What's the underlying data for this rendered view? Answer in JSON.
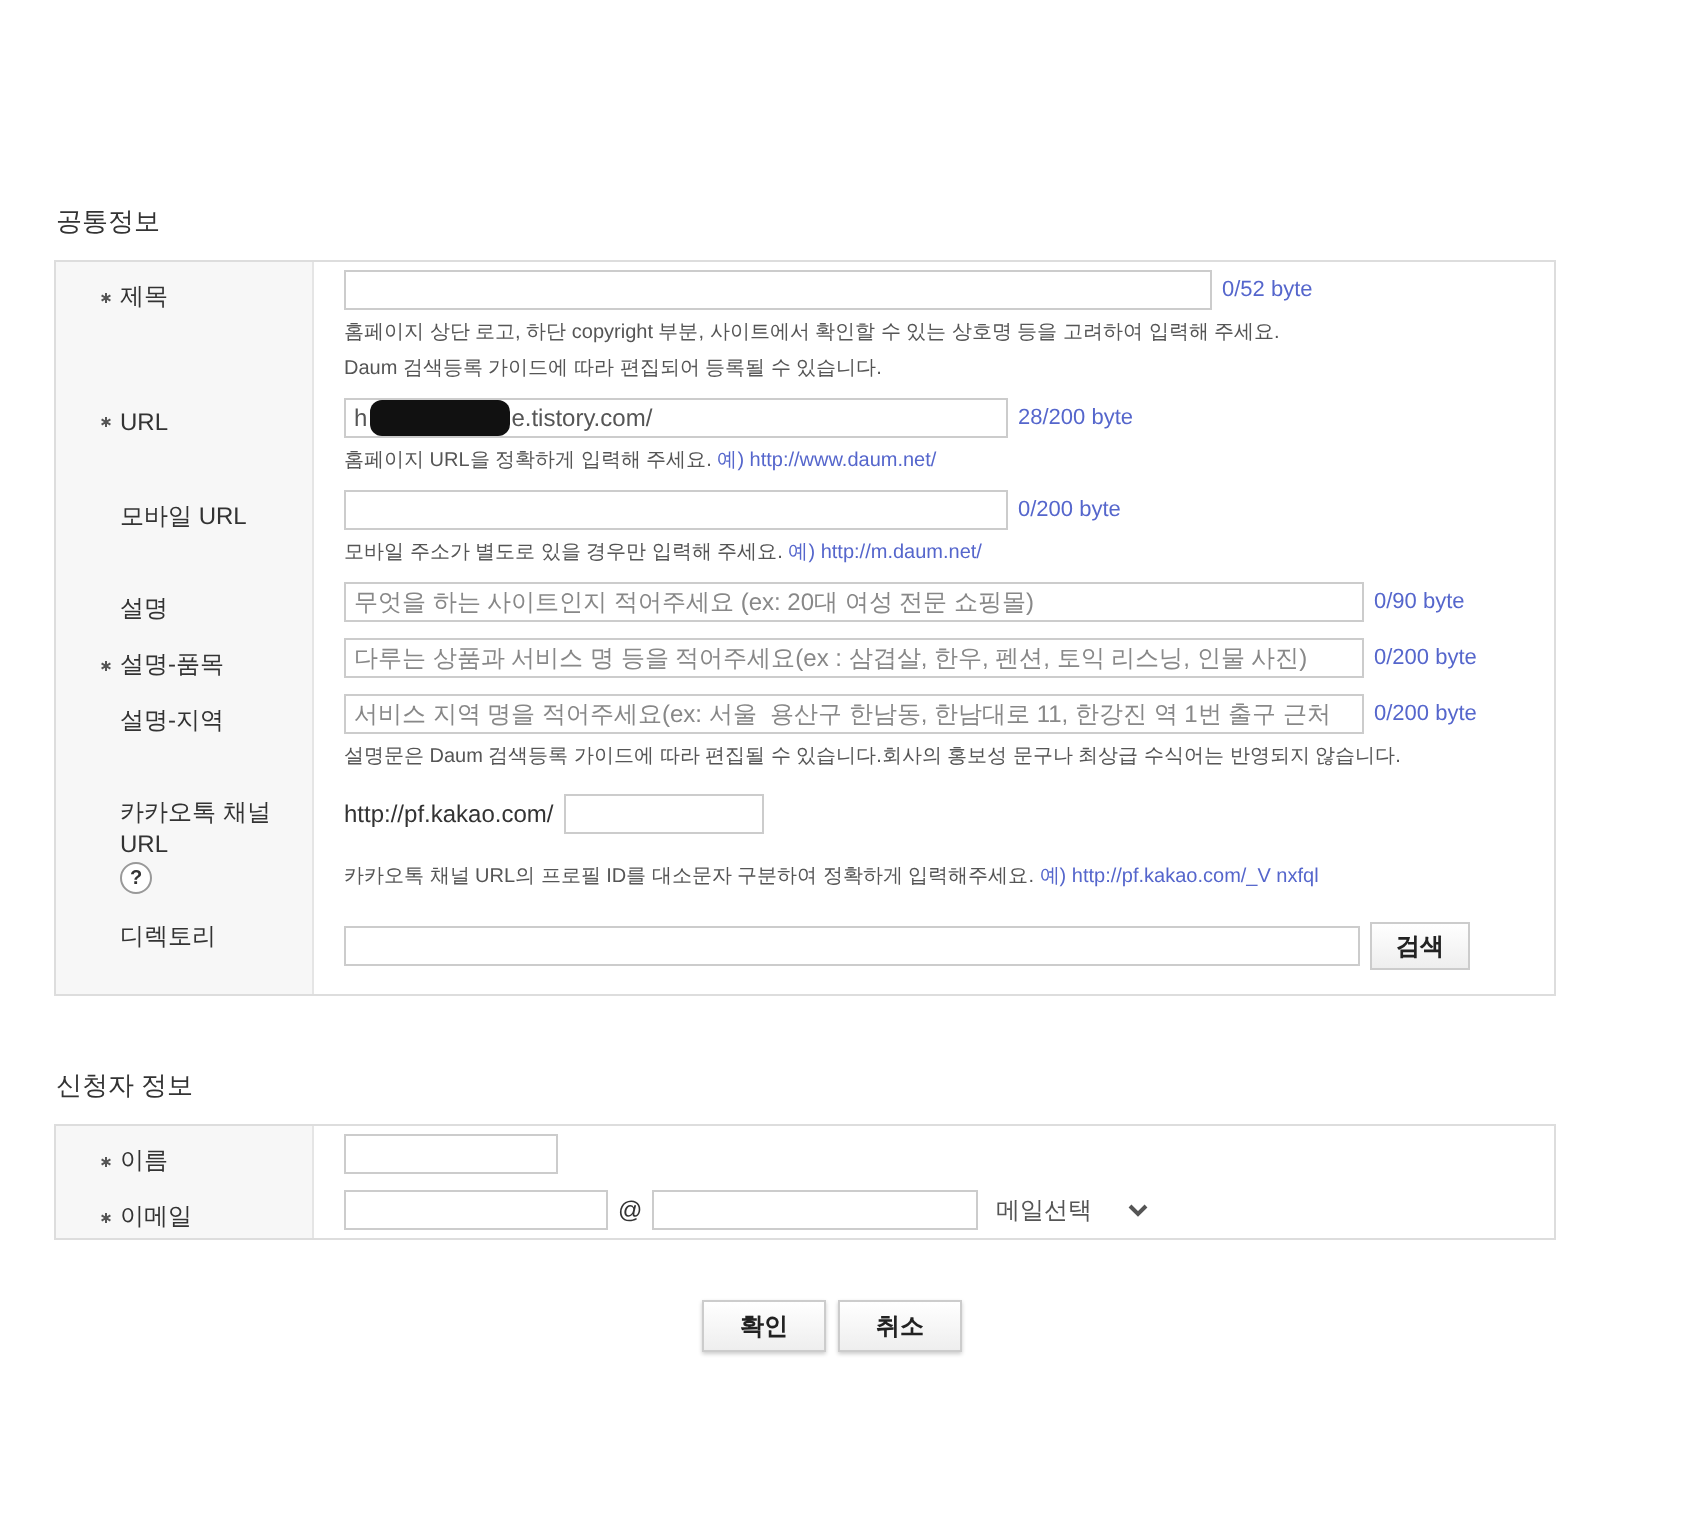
{
  "sections": [
    {
      "title": "공통정보",
      "rows": [
        {
          "kind": "text",
          "label": "제목",
          "required": true,
          "value": "",
          "placeholder": "",
          "counter": "0/52 byte",
          "hints": [
            {
              "text": "홈페이지 상단 로고, 하단 copyright 부분, 사이트에서 확인할 수 있는 상호명 등을 고려하여 입력해 주세요."
            },
            {
              "text": "Daum 검색등록 가이드에 따라 편집되어 등록될 수 있습니다."
            }
          ]
        },
        {
          "kind": "redacted",
          "label": "URL",
          "required": true,
          "value_start": "h",
          "value_end": "e.tistory.com/",
          "counter": "28/200 byte",
          "hints": [
            {
              "text": "홈페이지 URL을 정확하게 입력해 주세요.",
              "link": "예) http://www.daum.net/"
            }
          ]
        },
        {
          "kind": "text",
          "label": "모바일 URL",
          "required": false,
          "value": "",
          "placeholder": "",
          "counter": "0/200 byte",
          "hints": [
            {
              "text": "모바일 주소가 별도로 있을 경우만 입력해 주세요.",
              "link": "예) http://m.daum.net/"
            }
          ]
        },
        {
          "kind": "text",
          "label": "설명",
          "required": false,
          "value": "",
          "placeholder": "무엇을 하는 사이트인지 적어주세요 (ex: 20대 여성 전문 쇼핑몰)",
          "counter": "0/90 byte",
          "hints": []
        },
        {
          "kind": "text",
          "label": "설명-품목",
          "required": true,
          "value": "",
          "placeholder": "다루는 상품과 서비스 명 등을 적어주세요(ex : 삼겹살, 한우, 펜션, 토익 리스닝, 인물 사진)",
          "counter": "0/200 byte",
          "hints": []
        },
        {
          "kind": "text",
          "label": "설명-지역",
          "required": false,
          "value": "",
          "placeholder": "서비스 지역 명을 적어주세요(ex: 서울  용산구 한남동, 한남대로 11, 한강진 역 1번 출구 근처",
          "counter": "0/200 byte",
          "hints": [
            {
              "text": "설명문은 Daum 검색등록 가이드에 따라 편집될 수 있습니다.회사의 홍보성 문구나 최상급 수식어는 반영되지 않습니다."
            }
          ]
        },
        {
          "kind": "kakao",
          "label": "카카오톡 채널 URL",
          "help": "?",
          "required": false,
          "prefix": "http://pf.kakao.com/",
          "value": "",
          "hints": [
            {
              "text": "카카오톡 채널 URL의 프로필 ID를 대소문자 구분하여 정확하게 입력해주세요.",
              "link": "예) http://pf.kakao.com/_V nxfql"
            }
          ]
        },
        {
          "kind": "directory",
          "label": "디렉토리",
          "required": false,
          "value": "",
          "button": "검색",
          "hints": []
        }
      ]
    },
    {
      "title": "신청자 정보",
      "rows": [
        {
          "kind": "text",
          "label": "이름",
          "required": true,
          "value": "",
          "placeholder": "",
          "hints": []
        },
        {
          "kind": "email",
          "label": "이메일",
          "required": true,
          "user": "",
          "at": "@",
          "domain": "",
          "select": "메일선택",
          "hints": []
        }
      ]
    }
  ],
  "buttons": [
    "확인",
    "취소"
  ]
}
